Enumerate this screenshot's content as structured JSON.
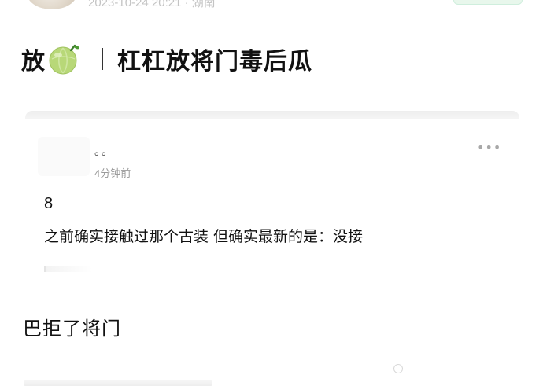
{
  "post": {
    "meta": "2023-10-24 20:21 · 湖南",
    "headline": {
      "prefix": "放",
      "icon": "melon-icon",
      "title": "杠杠放将门毒后瓜"
    },
    "quoted_card": {
      "author": "。。",
      "time": "4分钟前",
      "more": "•••",
      "number": "8",
      "text": "之前确实接触过那个古装 但确实最新的是：没接"
    },
    "paragraph": "巴拒了将门"
  },
  "colors": {
    "melon": "#b9d97a",
    "follow": "#e8f7ec"
  }
}
